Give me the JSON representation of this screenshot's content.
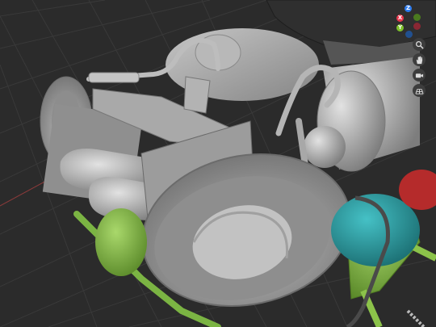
{
  "app": "3D Viewport",
  "gizmo": {
    "axes": [
      {
        "key": "z_pos",
        "label": "Z",
        "color": "#2d7cf0"
      },
      {
        "key": "x_pos",
        "label": "X",
        "color": "#e8374d"
      },
      {
        "key": "y_pos",
        "label": "Y",
        "color": "#7ec02a"
      },
      {
        "key": "x_neg",
        "label": "",
        "color": "#8a2733"
      },
      {
        "key": "y_neg",
        "label": "",
        "color": "#4b7a1f"
      },
      {
        "key": "z_neg",
        "label": "",
        "color": "#21508f"
      }
    ]
  },
  "nav_tools": [
    {
      "name": "zoom",
      "icon": "zoom-icon"
    },
    {
      "name": "pan",
      "icon": "hand-icon"
    },
    {
      "name": "camera",
      "icon": "camera-icon"
    },
    {
      "name": "perspective",
      "icon": "grid-icon"
    }
  ],
  "colors": {
    "background": "#2b2b2b",
    "grid": "#393939",
    "x_axis_line": "#8a3a3a",
    "model_grey": "#9a9a9a",
    "accent_green": "#8cc34a",
    "accent_teal": "#2aa3a8",
    "accent_red": "#b52b2b"
  }
}
